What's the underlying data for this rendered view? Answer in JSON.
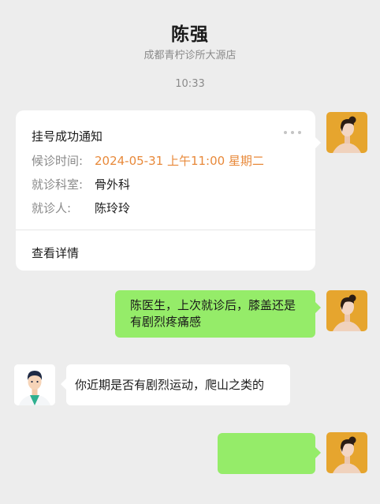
{
  "header": {
    "title": "陈强",
    "subtitle": "成都青柠诊所大源店"
  },
  "timestamp": "10:33",
  "card": {
    "title": "挂号成功通知",
    "rows": [
      {
        "label": "候诊时间:",
        "value": "2024-05-31 上午11:00 星期二"
      },
      {
        "label": "就诊科室:",
        "value": "骨外科"
      },
      {
        "label": "就诊人:",
        "value": "陈玲玲"
      }
    ],
    "link": "查看详情"
  },
  "messages": [
    {
      "sender": "patient",
      "text": "陈医生，上次就诊后，膝盖还是有剧烈疼痛感"
    },
    {
      "sender": "doctor",
      "text": "你近期是否有剧烈运动，爬山之类的"
    },
    {
      "sender": "patient",
      "text": ""
    }
  ],
  "colors": {
    "background": "#ededed",
    "bubble_self": "#95ec69",
    "bubble_other": "#ffffff",
    "accent_time": "#e8893a",
    "avatar_bg_patient": "#e6a52e"
  },
  "icons": {
    "patient_avatar": "woman-portrait-avatar",
    "doctor_avatar": "doctor-avatar",
    "more": "ellipsis-icon"
  }
}
